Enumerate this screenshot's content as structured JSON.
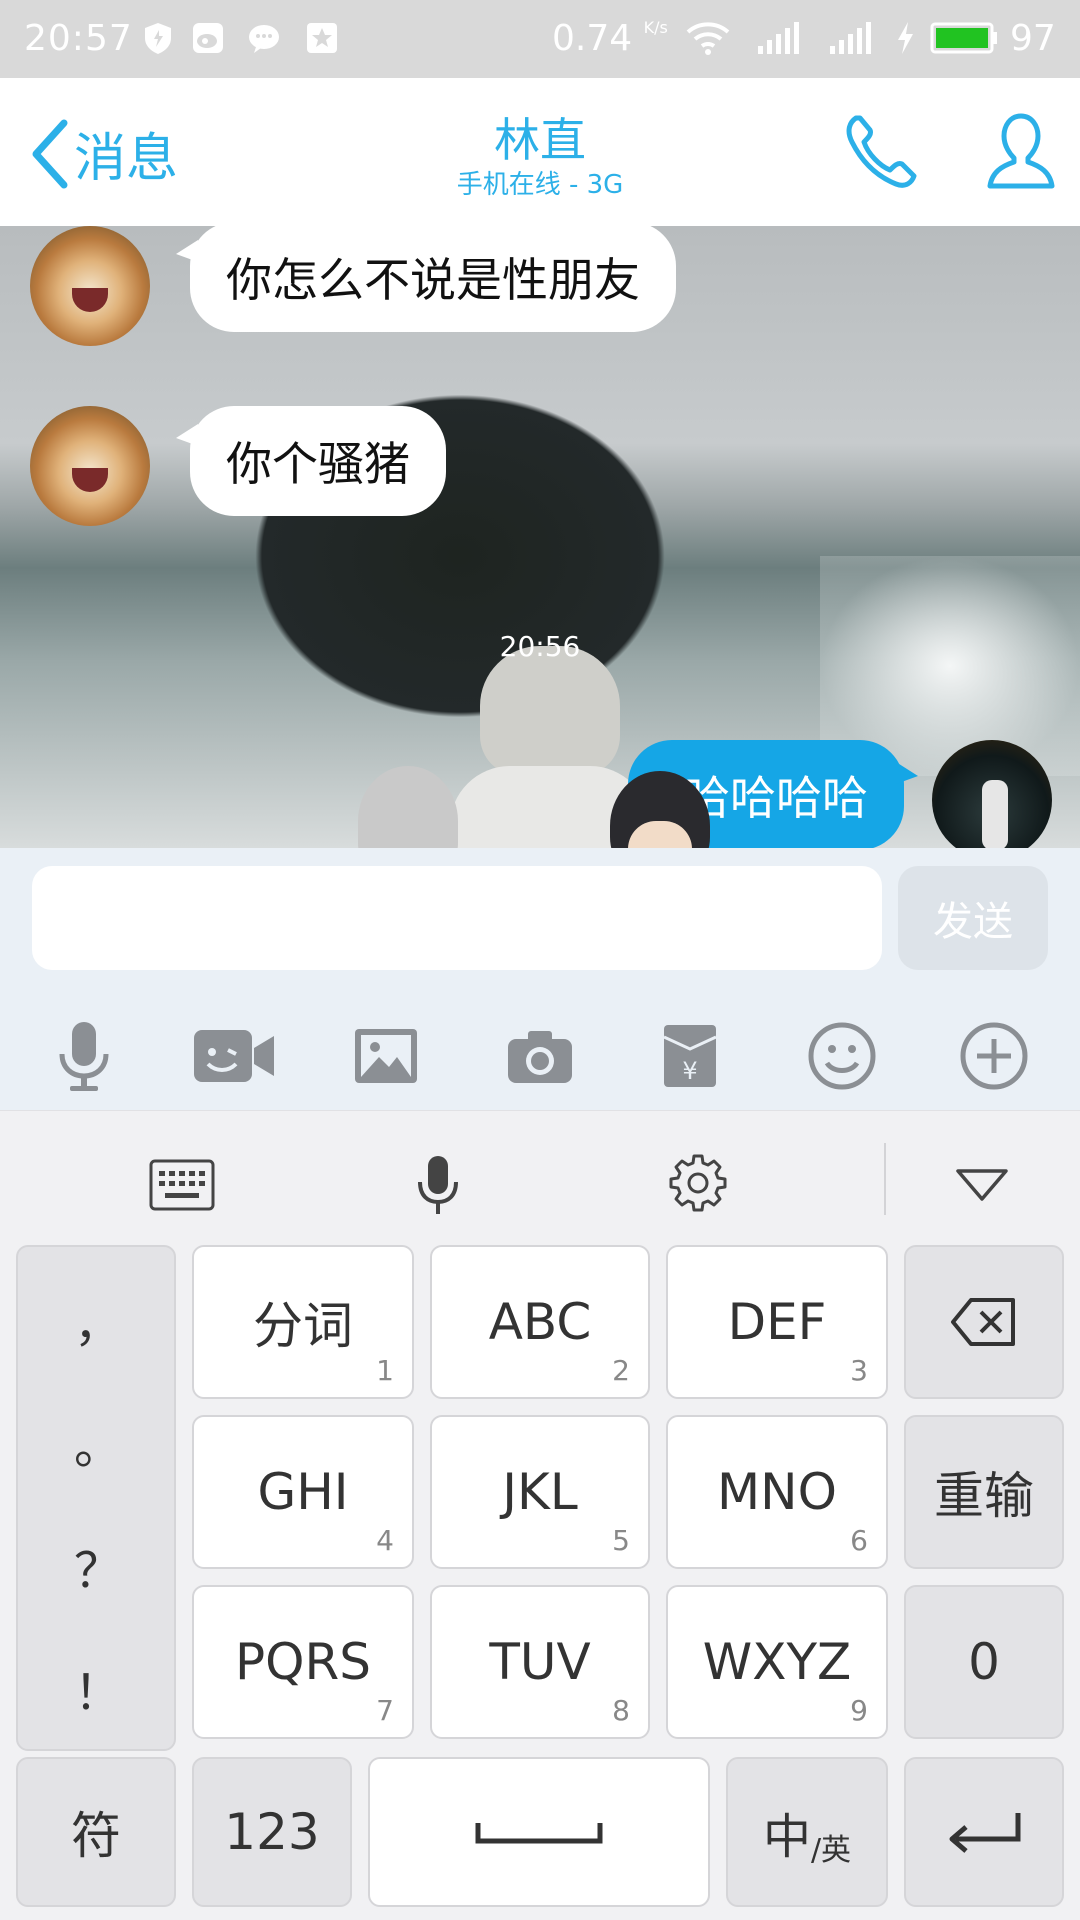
{
  "status_bar": {
    "time": "20:57",
    "speed": "0.74",
    "speed_unit": "K/s",
    "battery": "97",
    "icons": [
      "shield-icon",
      "weibo-icon",
      "wechat-icon",
      "star-icon",
      "wifi-icon",
      "signal-4g-icon",
      "signal-icon",
      "charging-icon",
      "battery-icon"
    ]
  },
  "header": {
    "back_label": "消息",
    "title": "林直",
    "subtitle": "手机在线 - 3G"
  },
  "chat": {
    "messages": [
      {
        "side": "left",
        "text": "你怎么不说是性朋友"
      },
      {
        "side": "left",
        "text": "你个骚猪"
      },
      {
        "side": "right",
        "text": "哈哈哈哈"
      }
    ],
    "timestamp": "20:56"
  },
  "input": {
    "placeholder": "",
    "send_label": "发送"
  },
  "toolbar": {
    "icons": [
      "microphone-icon",
      "video-call-icon",
      "image-icon",
      "camera-icon",
      "red-packet-icon",
      "emoji-icon",
      "plus-icon"
    ]
  },
  "keyboard": {
    "top_icons": [
      "keyboard-icon",
      "voice-input-icon",
      "settings-icon",
      "collapse-icon"
    ],
    "punctuation": [
      "，",
      "。",
      "？",
      "！"
    ],
    "keys_row1": [
      {
        "label": "分词",
        "num": "1"
      },
      {
        "label": "ABC",
        "num": "2"
      },
      {
        "label": "DEF",
        "num": "3"
      }
    ],
    "keys_row2": [
      {
        "label": "GHI",
        "num": "4"
      },
      {
        "label": "JKL",
        "num": "5"
      },
      {
        "label": "MNO",
        "num": "6"
      }
    ],
    "keys_row3": [
      {
        "label": "PQRS",
        "num": "7"
      },
      {
        "label": "TUV",
        "num": "8"
      },
      {
        "label": "WXYZ",
        "num": "9"
      }
    ],
    "reinput": "重输",
    "zero": "0",
    "symbols": "符",
    "numbers": "123",
    "lang_main": "中",
    "lang_sub": "/英"
  }
}
